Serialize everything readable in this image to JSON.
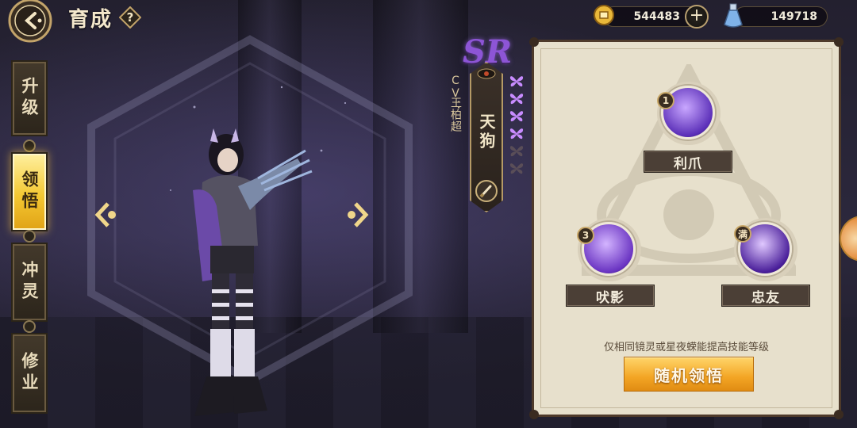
{
  "header": {
    "title": "育成",
    "help_label": "?",
    "coins": "544483",
    "plus_label": "+",
    "potions": "149718"
  },
  "tabs": [
    {
      "label": "升级",
      "active": false
    },
    {
      "label": "领悟",
      "active": true
    },
    {
      "label": "冲灵",
      "active": false
    },
    {
      "label": "修业",
      "active": false
    }
  ],
  "character": {
    "rarity": "SR",
    "name": "天狗",
    "cv_prefix": "CV：",
    "cv_name": "王柏超",
    "stars_filled": 4,
    "stars_total": 6
  },
  "skills": [
    {
      "name": "利爪",
      "level": "1",
      "colors": [
        "#c9a7ff",
        "#5b2fb8"
      ]
    },
    {
      "name": "吠影",
      "level": "3",
      "colors": [
        "#d3b4ff",
        "#6a34c2"
      ]
    },
    {
      "name": "忠友",
      "level": "满",
      "colors": [
        "#e0c8ff",
        "#4a1f9a"
      ]
    }
  ],
  "hint": "仅相同镜灵或星夜蝾能提高技能等级",
  "main_button": "随机领悟",
  "colors": {
    "accent_gold": "#f3a524",
    "active_tab": "#f4c832",
    "rarity_purple": "#8d55d6",
    "panel_bg": "#e7e0cc"
  },
  "icons": [
    "back-arrow-icon",
    "help-icon",
    "coin-icon",
    "plus-icon",
    "potion-icon",
    "left-arrow-icon",
    "right-arrow-icon",
    "brush-icon",
    "eye-icon",
    "butterfly-star-icon"
  ]
}
